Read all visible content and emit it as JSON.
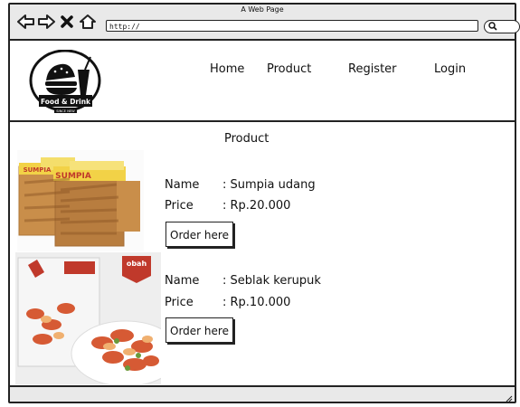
{
  "window": {
    "title": "A Web Page"
  },
  "browser": {
    "url": "http://"
  },
  "logo": {
    "text": "Food & Drink",
    "tagline": "SINCE NEW"
  },
  "nav": {
    "home": "Home",
    "product": "Product",
    "register": "Register",
    "login": "Login"
  },
  "page": {
    "section_title": "Product"
  },
  "products": [
    {
      "name_label": "Name",
      "name_value": ": Sumpia udang",
      "price_label": "Price",
      "price_value": ": Rp.20.000",
      "order_label": "Order here",
      "package_text": "SUMPIA"
    },
    {
      "name_label": "Name",
      "name_value": ": Seblak kerupuk",
      "price_label": "Price",
      "price_value": ": Rp.10.000",
      "order_label": "Order here",
      "brand_text": "obah"
    }
  ]
}
